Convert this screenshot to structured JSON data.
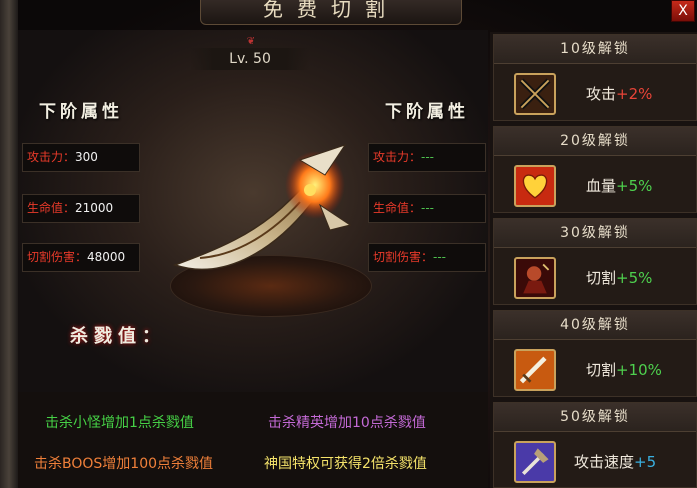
{
  "window": {
    "title": "免费切割",
    "close_label": "X"
  },
  "level": {
    "label": "Lv. 50"
  },
  "left_attrs": {
    "heading": "下阶属性",
    "stats": [
      {
        "label": "攻击力：",
        "value": "300"
      },
      {
        "label": "生命值：",
        "value": "21000"
      },
      {
        "label": "切割伤害：",
        "value": "48000"
      }
    ]
  },
  "right_attrs": {
    "heading": "下阶属性",
    "stats": [
      {
        "label": "攻击力：",
        "value": "---"
      },
      {
        "label": "生命值：",
        "value": "---"
      },
      {
        "label": "切割伤害：",
        "value": "---"
      }
    ]
  },
  "kill_value": {
    "label": "杀戮值："
  },
  "hints": [
    "击杀小怪增加1点杀戮值",
    "击杀精英增加10点杀戮值",
    "击杀BOOS增加100点杀戮值",
    "神国特权可获得2倍杀戮值"
  ],
  "unlocks": [
    {
      "title": "10级解锁",
      "stat": "攻击",
      "bonus": "+2%",
      "icon": "crossed-swords-icon",
      "bonus_color": "#e84438"
    },
    {
      "title": "20级解锁",
      "stat": "血量",
      "bonus": "+5%",
      "icon": "heart-icon",
      "bonus_color": "#4ed04e"
    },
    {
      "title": "30级解锁",
      "stat": "切割",
      "bonus": "+5%",
      "icon": "warrior-icon",
      "bonus_color": "#4ed04e"
    },
    {
      "title": "40级解锁",
      "stat": "切割",
      "bonus": "+10%",
      "icon": "sword-icon",
      "bonus_color": "#4ed04e"
    },
    {
      "title": "50级解锁",
      "stat": "攻击速度",
      "bonus": "+5",
      "icon": "axe-icon",
      "bonus_color": "#3ab0e0"
    }
  ]
}
